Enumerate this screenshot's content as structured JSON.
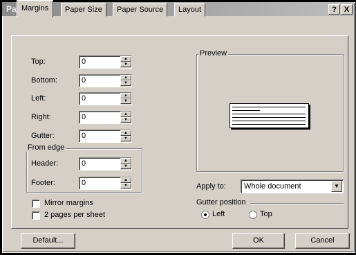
{
  "window": {
    "title": "Page Setup",
    "help_btn": "?",
    "close_btn": "X"
  },
  "tabs": [
    {
      "label": "Margins"
    },
    {
      "label": "Paper Size"
    },
    {
      "label": "Paper Source"
    },
    {
      "label": "Layout"
    }
  ],
  "margins": {
    "top": {
      "label": "Top:",
      "value": "0"
    },
    "bottom": {
      "label": "Bottom:",
      "value": "0"
    },
    "left": {
      "label": "Left:",
      "value": "0"
    },
    "right": {
      "label": "Right:",
      "value": "0"
    },
    "gutter": {
      "label": "Gutter:",
      "value": "0"
    }
  },
  "from_edge": {
    "title": "From edge",
    "header": {
      "label": "Header:",
      "value": "0"
    },
    "footer": {
      "label": "Footer:",
      "value": "0"
    }
  },
  "options": {
    "mirror": {
      "label": "Mirror margins",
      "checked": false
    },
    "two_pages": {
      "label": "2 pages per sheet",
      "checked": false
    }
  },
  "preview": {
    "title": "Preview"
  },
  "apply_to": {
    "label": "Apply to:",
    "value": "Whole document"
  },
  "gutter_position": {
    "title": "Gutter position",
    "left": {
      "label": "Left",
      "selected": true
    },
    "top": {
      "label": "Top",
      "selected": false
    }
  },
  "buttons": {
    "default": "Default...",
    "ok": "OK",
    "cancel": "Cancel"
  }
}
